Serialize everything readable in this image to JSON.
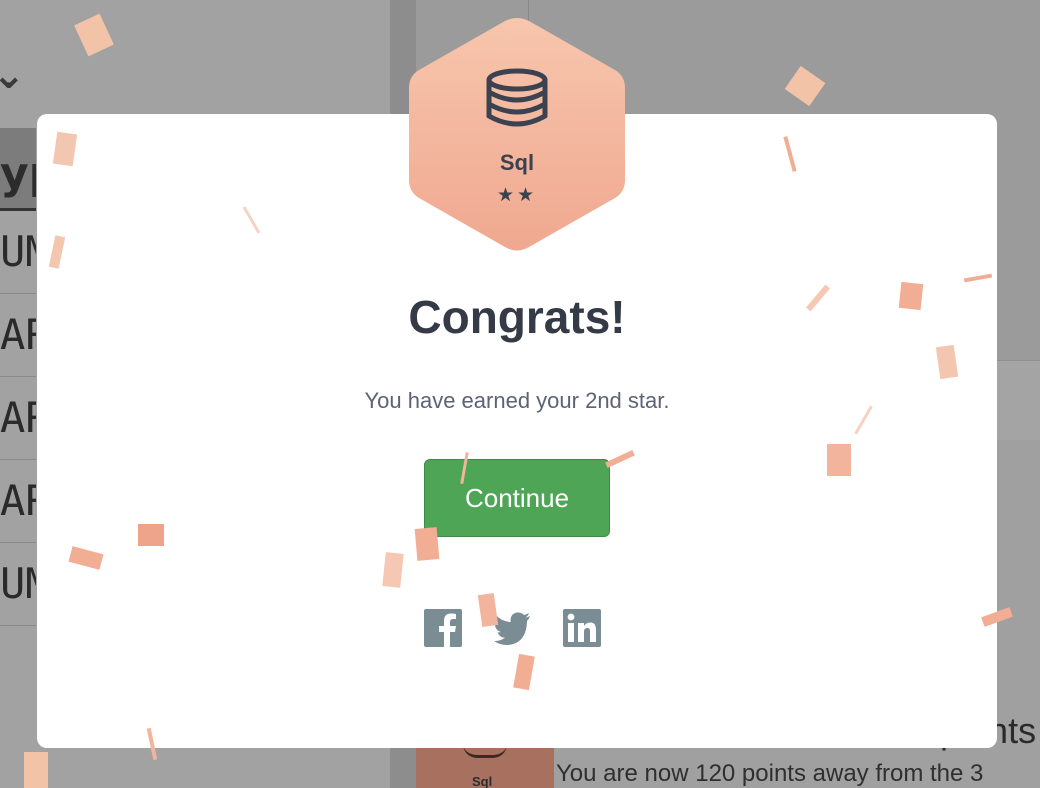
{
  "background": {
    "table_header_text": "ype",
    "table_rows": [
      "UM",
      "AR",
      "AR",
      "AR",
      "UM"
    ],
    "badge_label": "Sql",
    "points_heading": "points",
    "points_message": "You are now 120 points away from the 3"
  },
  "modal": {
    "badge": {
      "icon": "database-stack-icon",
      "label": "Sql",
      "stars": "★★",
      "star_count": 2
    },
    "title": "Congrats!",
    "message": "You have earned your 2nd star.",
    "continue_label": "Continue",
    "share": [
      {
        "name": "facebook",
        "icon": "facebook-icon"
      },
      {
        "name": "twitter",
        "icon": "twitter-icon"
      },
      {
        "name": "linkedin",
        "icon": "linkedin-icon"
      }
    ]
  },
  "colors": {
    "overlay": "#9c9c9c",
    "badge_gradient_top": "#f7c6ad",
    "badge_gradient_bottom": "#f0a890",
    "confetti": "#f2a98c",
    "button": "#4fa556",
    "title_text": "#353a47",
    "body_text": "#5b6375",
    "share_icon": "#7a8c94"
  }
}
